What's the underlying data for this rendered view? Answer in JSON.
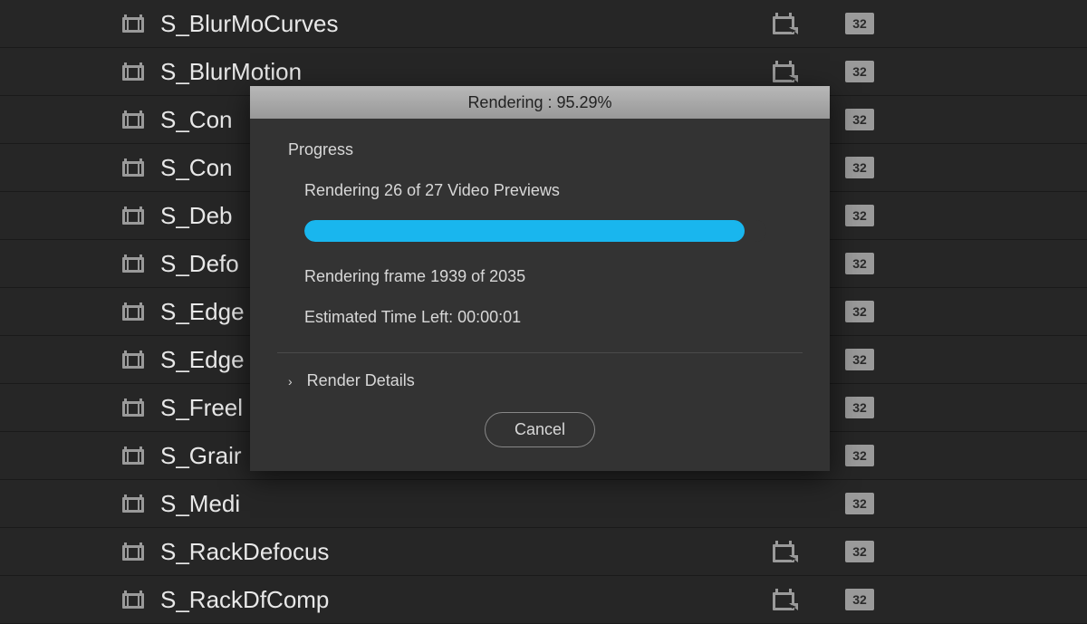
{
  "effects": [
    {
      "name": "S_BlurMoCurves"
    },
    {
      "name": "S_BlurMotion"
    },
    {
      "name": "S_Con"
    },
    {
      "name": "S_Con"
    },
    {
      "name": "S_Deb"
    },
    {
      "name": "S_Defo"
    },
    {
      "name": "S_Edge"
    },
    {
      "name": "S_Edge"
    },
    {
      "name": "S_Freel"
    },
    {
      "name": "S_Grair"
    },
    {
      "name": "S_Medi"
    },
    {
      "name": "S_RackDefocus"
    },
    {
      "name": "S_RackDfComp"
    }
  ],
  "badge": "32",
  "dialog": {
    "title": "Rendering : 95.29%",
    "progress_label": "Progress",
    "preview_text": "Rendering 26 of 27 Video Previews",
    "progress_percent": 95.29,
    "frame_text": "Rendering frame 1939 of 2035",
    "time_text": "Estimated Time Left: 00:00:01",
    "details_label": "Render Details",
    "cancel_label": "Cancel"
  }
}
